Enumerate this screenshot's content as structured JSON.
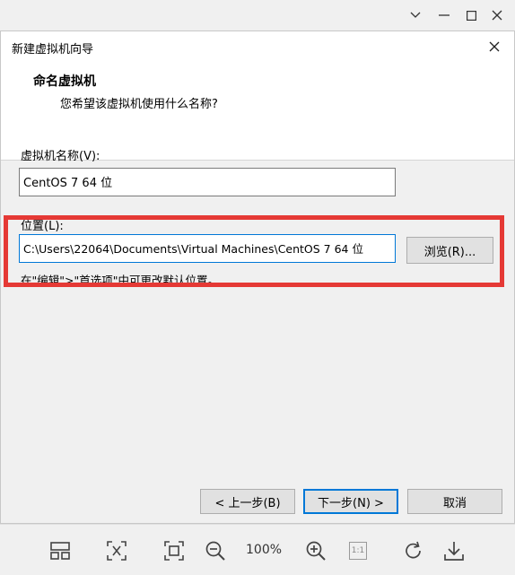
{
  "dialog": {
    "title": "新建虚拟机向导",
    "header": {
      "title": "命名虚拟机",
      "subtitle": "您希望该虚拟机使用什么名称?"
    },
    "name_label": "虚拟机名称(V):",
    "name_value": "CentOS 7 64 位",
    "location_label": "位置(L):",
    "location_value": "C:\\Users\\22064\\Documents\\Virtual Machines\\CentOS 7 64 位",
    "browse_label": "浏览(R)...",
    "hint": "在\"编辑\">\"首选项\"中可更改默认位置。",
    "buttons": {
      "back": "< 上一步(B)",
      "next": "下一步(N) >",
      "cancel": "取消"
    }
  },
  "viewer": {
    "zoom": "100%",
    "actual_size_label": "1:1"
  },
  "colors": {
    "highlight": "#e53935",
    "focus": "#0078d7"
  }
}
